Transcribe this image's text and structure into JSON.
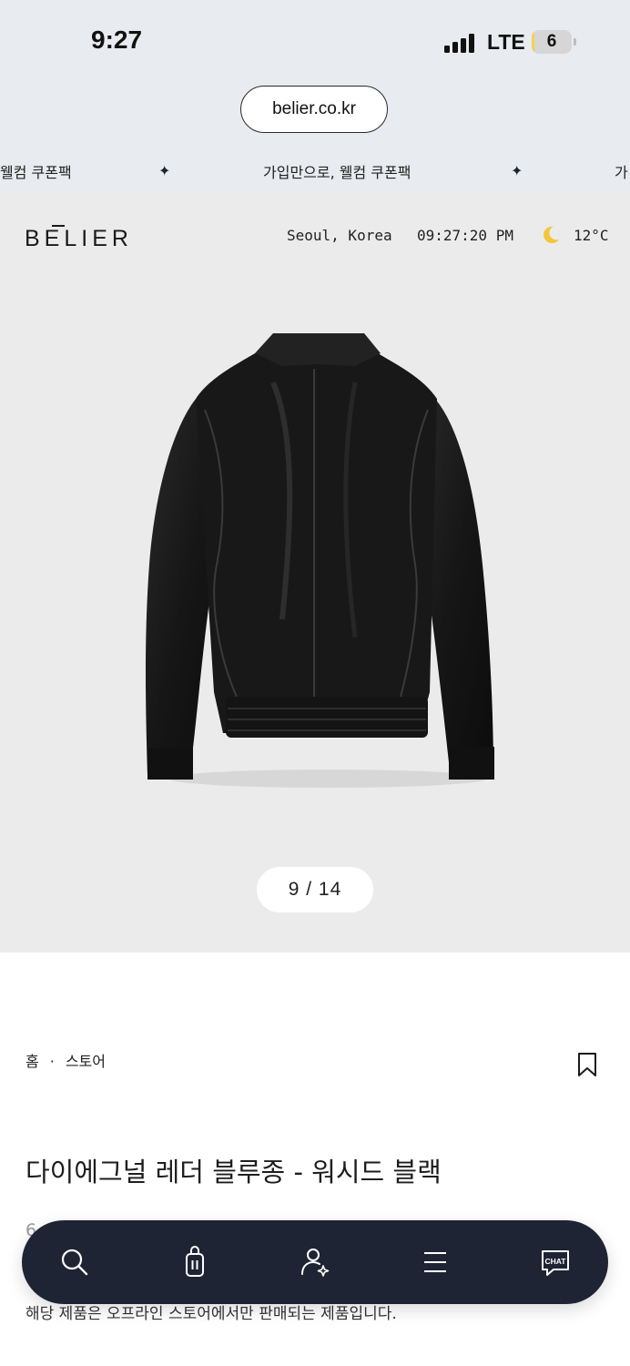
{
  "status_bar": {
    "time": "9:27",
    "network": "LTE",
    "battery_level": "6",
    "battery_fraction": 0.06,
    "signal_bars": 4
  },
  "browser": {
    "url": "belier.co.kr"
  },
  "announcement": {
    "items": [
      "웰컴 쿠폰팩",
      "가입만으로, 웰컴 쿠폰팩",
      "가"
    ],
    "separator_icon": "sparkle-star-icon"
  },
  "header": {
    "logo": "BELIER",
    "location": "Seoul, Korea",
    "clock": "09:27:20 PM",
    "weather_icon": "moon-icon",
    "temperature": "12°C"
  },
  "gallery": {
    "image_icon": "leather-jacket-back-image",
    "counter": "9 / 14",
    "current": 9,
    "total": 14
  },
  "breadcrumb": {
    "items": [
      "홈",
      "스토어"
    ],
    "separator": "·"
  },
  "product": {
    "title": "다이에그널 레더 블루종 - 워시드 블랙",
    "price_line": "6,, 0,000원",
    "notice": "해당 제품은 오프라인 스토어에서만 판매되는 제품입니다."
  },
  "bottom_nav": {
    "items": [
      {
        "icon": "search-icon"
      },
      {
        "icon": "shopping-bag-icon"
      },
      {
        "icon": "user-account-icon"
      },
      {
        "icon": "menu-icon"
      },
      {
        "icon": "chat-icon",
        "label": "CHAT"
      }
    ]
  },
  "colors": {
    "chrome_bg": "#e8ebef",
    "hero_bg": "#ebebeb",
    "nav_bg": "#1e2434",
    "battery_fill": "#f3d152"
  }
}
